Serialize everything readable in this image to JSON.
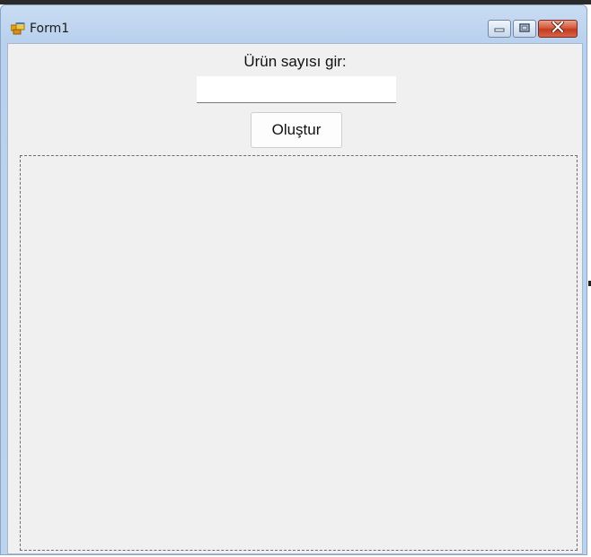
{
  "window": {
    "title": "Form1",
    "icons": {
      "app": "form-app-icon",
      "minimize": "minimize-icon",
      "maximize": "maximize-icon",
      "close": "close-icon"
    }
  },
  "form": {
    "prompt_label": "Ürün sayısı gir:",
    "product_count_input": {
      "value": "",
      "placeholder": ""
    },
    "create_button_label": "Oluştur"
  },
  "colors": {
    "client_background": "#f0f0f0",
    "titlebar": "#c9dcf2",
    "close_button": "#c33b20"
  }
}
